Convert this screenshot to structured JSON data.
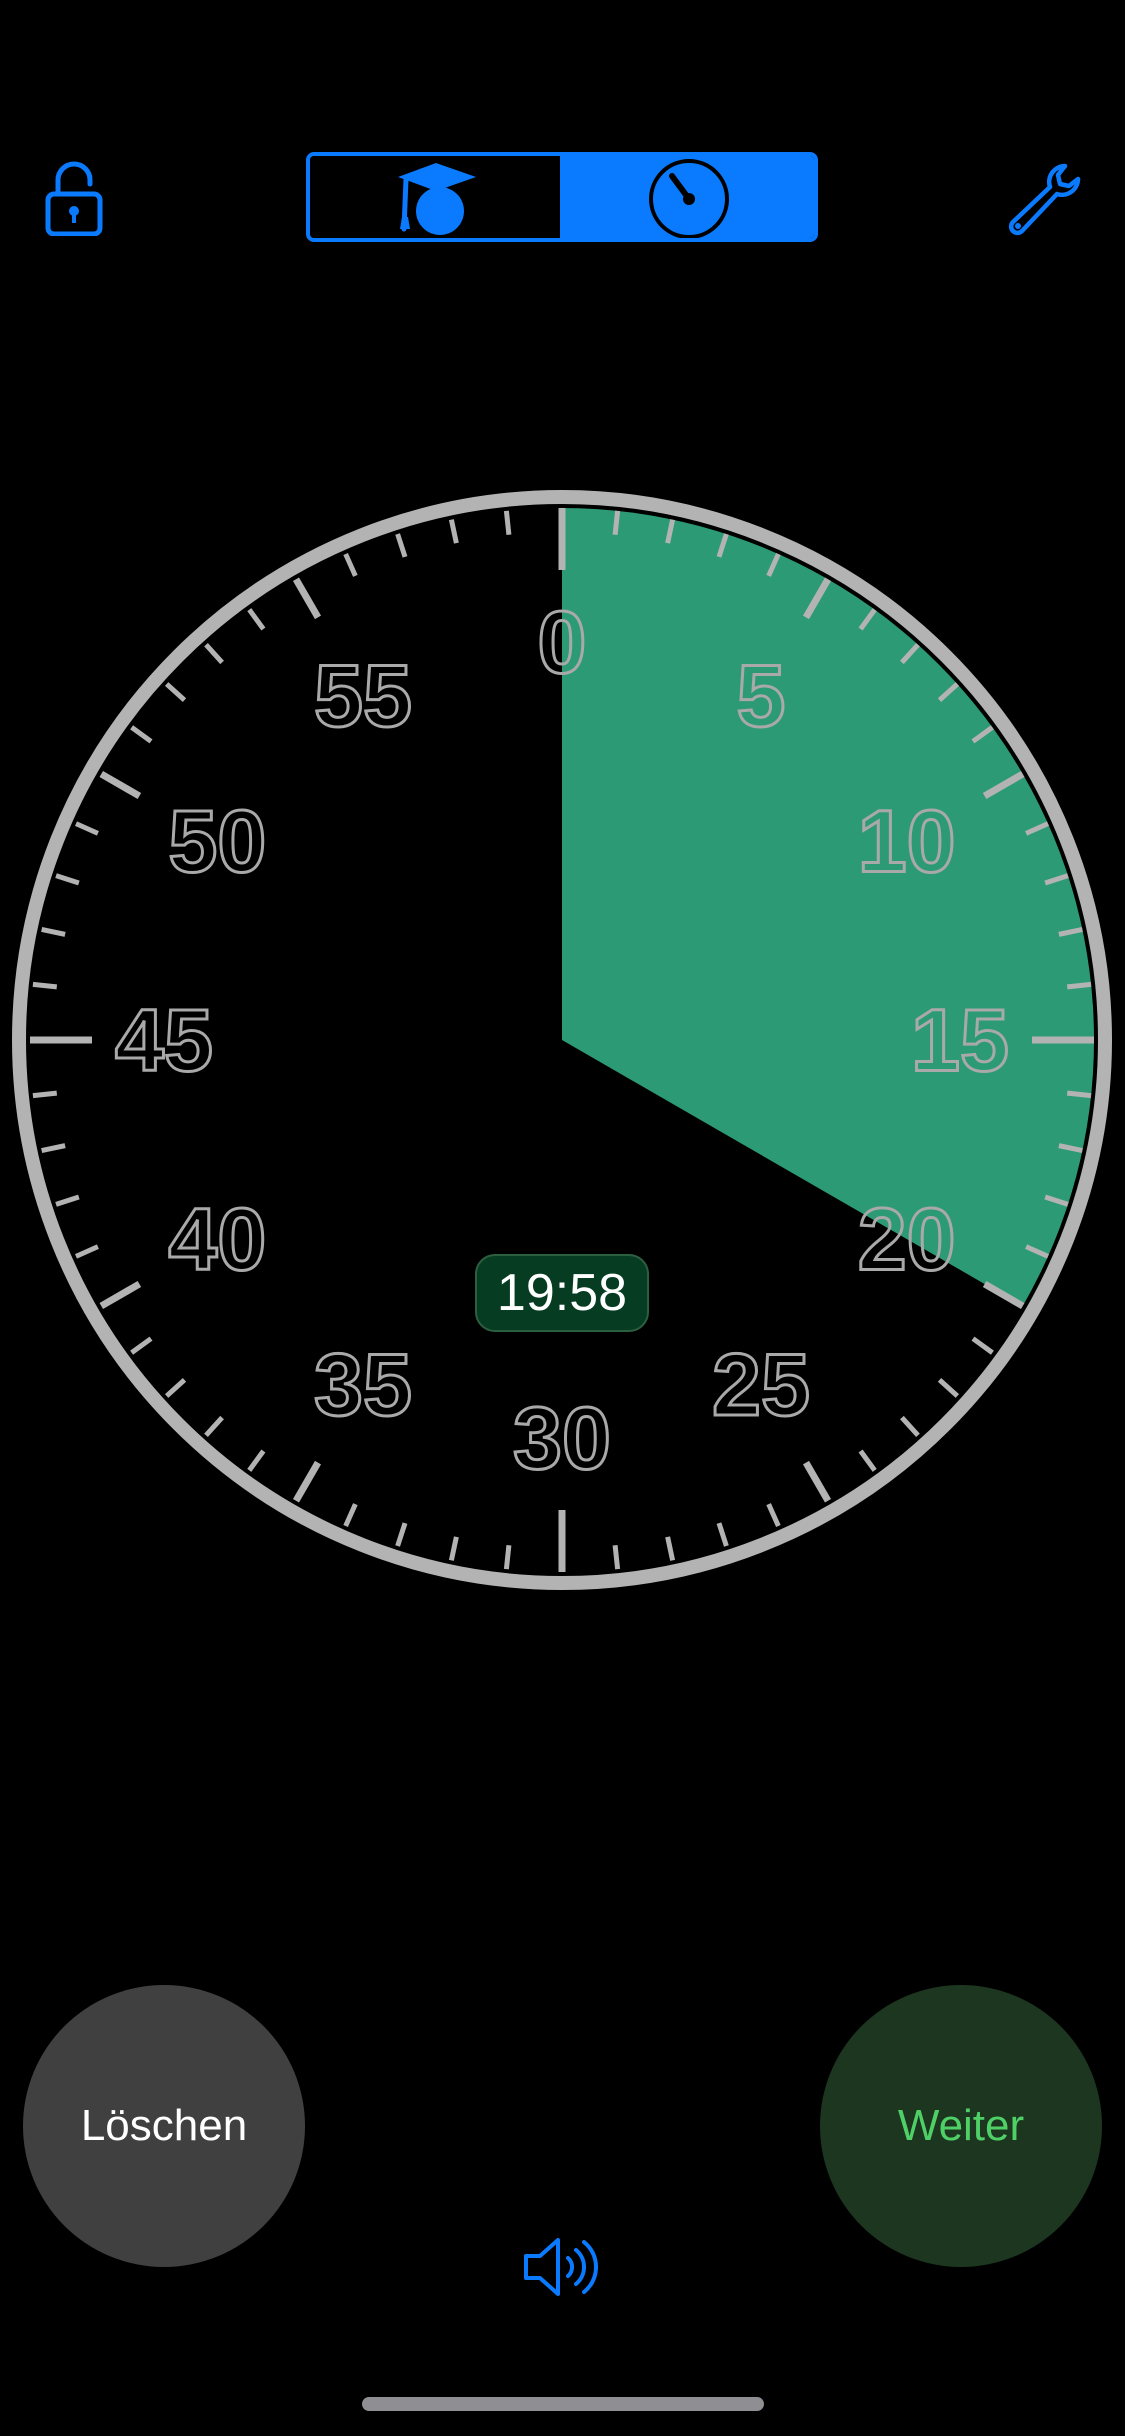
{
  "header": {
    "lock_icon": "lock-open-icon",
    "mode_tabs": [
      {
        "icon": "graduation-cap-icon",
        "selected": false
      },
      {
        "icon": "stopwatch-icon",
        "selected": true
      }
    ],
    "settings_icon": "wrench-icon"
  },
  "dial": {
    "numbers": [
      "0",
      "5",
      "10",
      "15",
      "20",
      "25",
      "30",
      "35",
      "40",
      "45",
      "50",
      "55"
    ],
    "remaining_minutes": 20,
    "max_minutes": 60,
    "fill_color": "#2C9A74",
    "rim_color": "#B3B3B3"
  },
  "timer": {
    "display": "19:58"
  },
  "controls": {
    "clear_label": "Löschen",
    "continue_label": "Weiter",
    "sound_icon": "speaker-wave-icon"
  },
  "colors": {
    "accent": "#0A7AFF",
    "continue_text": "#4FD067",
    "continue_bg": "#1C3620",
    "clear_bg": "#404040",
    "badge_bg": "#063D22"
  }
}
